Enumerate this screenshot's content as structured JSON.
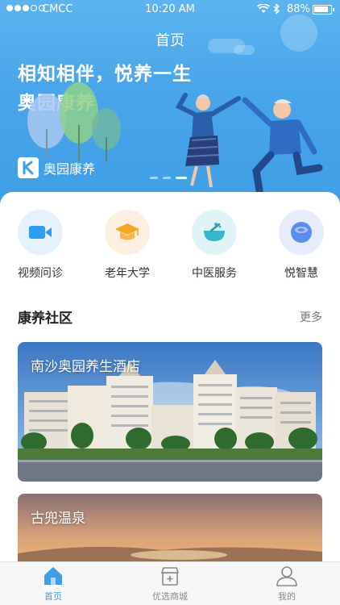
{
  "status_bar": {
    "carrier": "CMCC",
    "time": "10:20 AM",
    "battery": "88%"
  },
  "header": {
    "title": "首页"
  },
  "banner": {
    "slogan_line1": "相知相伴，悦养一生",
    "slogan_line2": "奥园康养",
    "brand_name": "奥园康养",
    "slide_count": 3,
    "active_slide": 3
  },
  "quick_entries": [
    {
      "label": "视频问诊",
      "icon": "video-camera-icon",
      "color": "#2e9cf0",
      "bg": "#e4f2fd"
    },
    {
      "label": "老年大学",
      "icon": "graduation-cap-icon",
      "color": "#f5a623",
      "bg": "#fdf0e0"
    },
    {
      "label": "中医服务",
      "icon": "herbal-bowl-icon",
      "color": "#34b7c9",
      "bg": "#e0f4f7"
    },
    {
      "label": "悦智慧",
      "icon": "smart-device-icon",
      "color": "#5b8df0",
      "bg": "#e6ecfb"
    }
  ],
  "community": {
    "title": "康养社区",
    "more": "更多",
    "cards": [
      {
        "name": "南沙奥园养生酒店"
      },
      {
        "name": "古兜温泉"
      }
    ]
  },
  "tabbar": {
    "tabs": [
      {
        "label": "首页",
        "icon": "home-icon",
        "active": true
      },
      {
        "label": "优选商城",
        "icon": "shop-icon",
        "active": false
      },
      {
        "label": "我的",
        "icon": "user-icon",
        "active": false
      }
    ]
  },
  "colors": {
    "primary": "#3e9fe8",
    "hero_top": "#5cb4ef",
    "hero_bottom": "#3f9ee6"
  }
}
